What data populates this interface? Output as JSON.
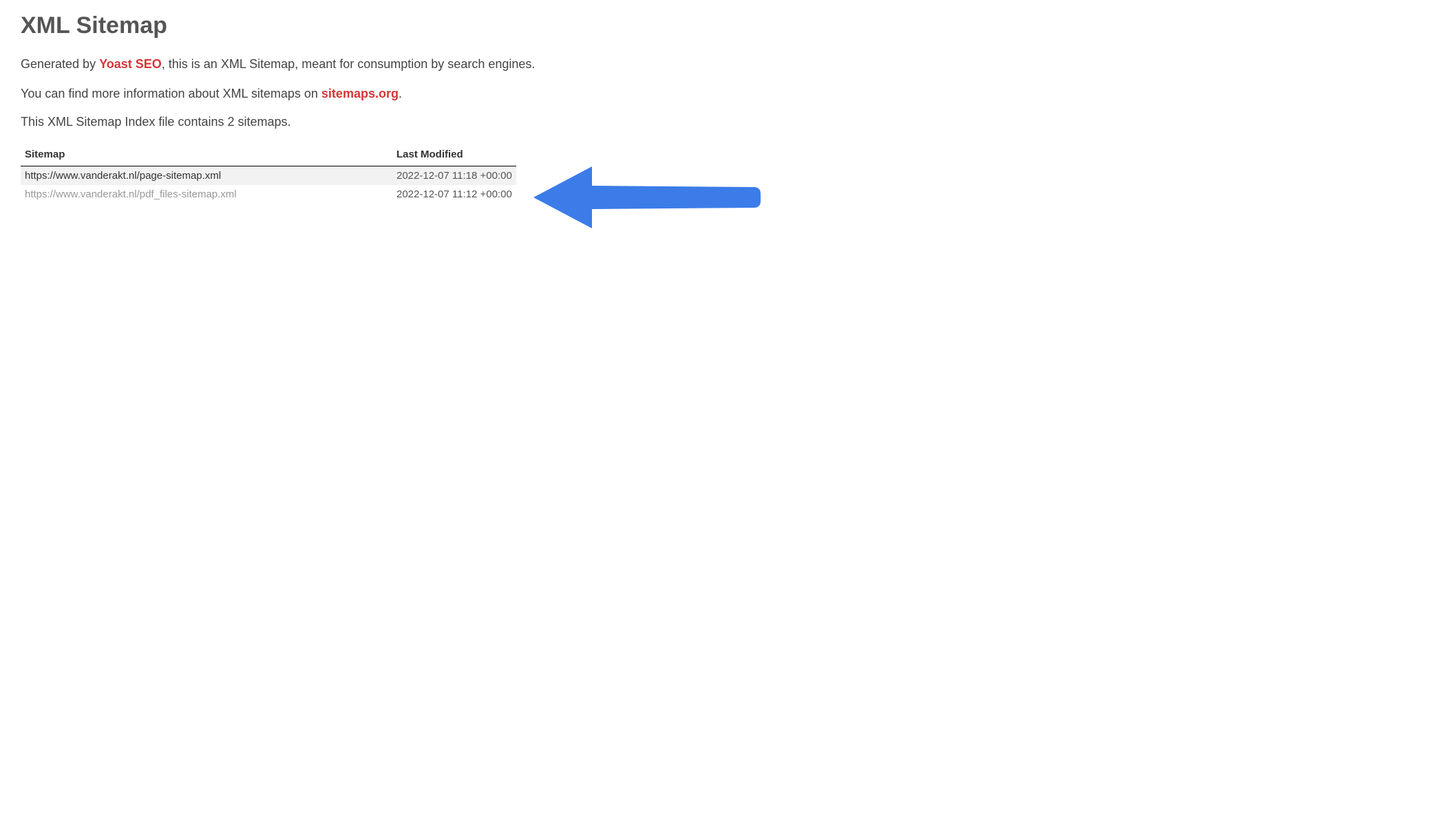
{
  "title": "XML Sitemap",
  "intro": {
    "generated_prefix": "Generated by ",
    "generated_link": "Yoast SEO",
    "generated_suffix": ", this is an XML Sitemap, meant for consumption by search engines.",
    "moreinfo_prefix": "You can find more information about XML sitemaps on ",
    "moreinfo_link": "sitemaps.org",
    "moreinfo_suffix": "."
  },
  "count_line": "This XML Sitemap Index file contains 2 sitemaps.",
  "table": {
    "headers": {
      "sitemap": "Sitemap",
      "last_modified": "Last Modified"
    },
    "rows": [
      {
        "url": "https://www.vanderakt.nl/page-sitemap.xml",
        "last_modified": "2022-12-07 11:18 +00:00",
        "visited": false
      },
      {
        "url": "https://www.vanderakt.nl/pdf_files-sitemap.xml",
        "last_modified": "2022-12-07 11:12 +00:00",
        "visited": true
      }
    ]
  }
}
